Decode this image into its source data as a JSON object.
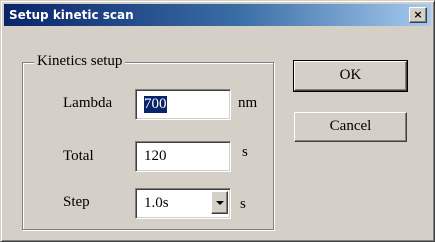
{
  "window": {
    "title": "Setup kinetic scan",
    "close_glyph": "×"
  },
  "group": {
    "legend": "Kinetics setup",
    "fields": {
      "lambda": {
        "label": "Lambda",
        "value": "700",
        "unit": "nm",
        "selected": true
      },
      "total": {
        "label": "Total",
        "value": "120",
        "unit": "s"
      },
      "step": {
        "label": "Step",
        "value": "1.0s",
        "unit": "s"
      }
    }
  },
  "buttons": {
    "ok_label": "OK",
    "cancel_label": "Cancel"
  },
  "icons": {
    "close": "close-icon",
    "dropdown": "chevron-down-icon"
  },
  "colors": {
    "titlebar_start": "#0a246a",
    "titlebar_end": "#a6caf0",
    "face": "#d4d0c8",
    "selection": "#0a246a"
  }
}
